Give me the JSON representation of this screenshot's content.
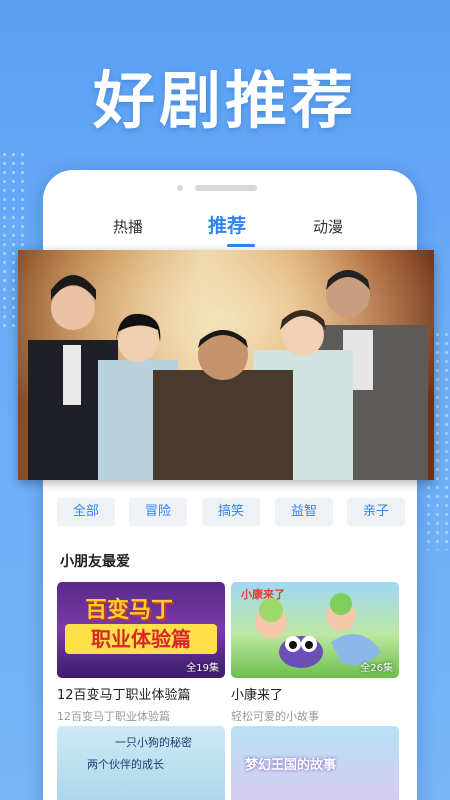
{
  "headline": "好剧推荐",
  "tabs": [
    {
      "label": "热播"
    },
    {
      "label": "推荐"
    },
    {
      "label": "动漫"
    }
  ],
  "categories": [
    "全部",
    "冒险",
    "搞笑",
    "益智",
    "亲子"
  ],
  "section_title": "小朋友最爱",
  "cards": [
    {
      "title": "12百变马丁职业体验篇",
      "subtitle": "12百变马丁职业体验篇",
      "episodes": "全19集",
      "thumb_text_top": "百变马丁",
      "thumb_text_bottom": "职业体验篇"
    },
    {
      "title": "小康来了",
      "subtitle": "轻松可爱的小故事",
      "episodes": "全26集",
      "thumb_text_top": "小康来了"
    }
  ],
  "row2": [
    {
      "thumb_text": "一只小狗的秘密",
      "thumb_text2": "两个伙伴的成长"
    },
    {
      "thumb_text": "梦幻王国的故事"
    }
  ],
  "colors": {
    "accent": "#2f86f0",
    "background": "#5aa0f3"
  }
}
